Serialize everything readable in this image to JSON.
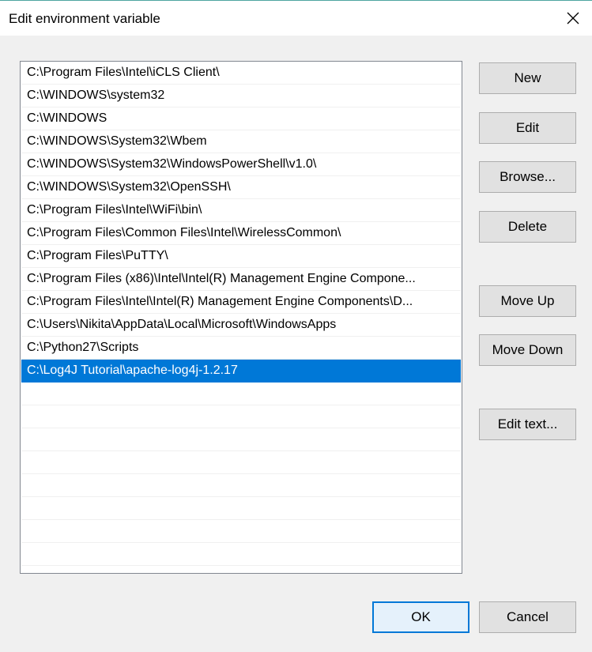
{
  "window": {
    "title": "Edit environment variable"
  },
  "paths": [
    "C:\\Program Files\\Intel\\iCLS Client\\",
    "C:\\WINDOWS\\system32",
    "C:\\WINDOWS",
    "C:\\WINDOWS\\System32\\Wbem",
    "C:\\WINDOWS\\System32\\WindowsPowerShell\\v1.0\\",
    "C:\\WINDOWS\\System32\\OpenSSH\\",
    "C:\\Program Files\\Intel\\WiFi\\bin\\",
    "C:\\Program Files\\Common Files\\Intel\\WirelessCommon\\",
    "C:\\Program Files\\PuTTY\\",
    "C:\\Program Files (x86)\\Intel\\Intel(R) Management Engine Compone...",
    "C:\\Program Files\\Intel\\Intel(R) Management Engine Components\\D...",
    "C:\\Users\\Nikita\\AppData\\Local\\Microsoft\\WindowsApps",
    "C:\\Python27\\Scripts",
    "C:\\Log4J Tutorial\\apache-log4j-1.2.17",
    "",
    "",
    "",
    "",
    "",
    "",
    "",
    "",
    ""
  ],
  "selected_index": 13,
  "buttons": {
    "new": "New",
    "edit": "Edit",
    "browse": "Browse...",
    "delete": "Delete",
    "move_up": "Move Up",
    "move_down": "Move Down",
    "edit_text": "Edit text...",
    "ok": "OK",
    "cancel": "Cancel"
  },
  "icons": {
    "close": "close-icon"
  },
  "colors": {
    "selection": "#0078d7",
    "button_face": "#e1e1e1",
    "dialog_bg": "#f0f0f0"
  }
}
